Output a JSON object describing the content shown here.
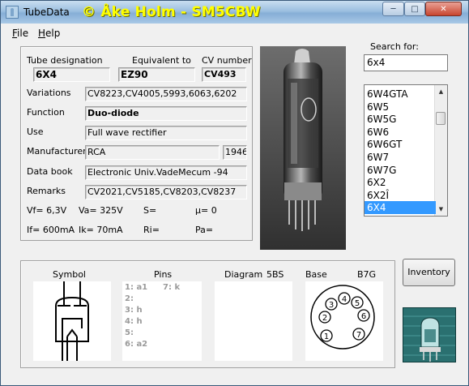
{
  "window": {
    "app_title": "TubeData",
    "banner": "© Åke Holm - SM5CBW",
    "controls": {
      "minimize": "─",
      "maximize": "□",
      "close": "✕"
    }
  },
  "menu": {
    "file": "File",
    "file_key": "F",
    "file_rest": "ile",
    "help": "Help",
    "help_key": "H",
    "help_rest": "elp"
  },
  "tube": {
    "designation_label": "Tube designation",
    "designation": "6X4",
    "equivalent_label": "Equivalent to",
    "equivalent": "EZ90",
    "cv_label": "CV number",
    "cv": "CV493",
    "variations_label": "Variations",
    "variations": "CV8223,CV4005,5993,6063,6202",
    "function_label": "Function",
    "function": "Duo-diode",
    "use_label": "Use",
    "use": "Full wave rectifier",
    "manufacturer_label": "Manufacturer",
    "manufacturer": "RCA",
    "year": "1946",
    "databook_label": "Data book",
    "databook": "Electronic Univ.VadeMecum -94",
    "remarks_label": "Remarks",
    "remarks": "CV2021,CV5185,CV8203,CV8237",
    "vf": "Vf= 6,3V",
    "va": "Va=  325V",
    "s": "S=",
    "mu": "µ=    0",
    "if": "If= 600mA",
    "ik": "Ik=   70mA",
    "ri": "Ri=",
    "pa": "Pa="
  },
  "search": {
    "label": "Search for:",
    "value": "6x4",
    "items": [
      "6W4GTA",
      "6W5",
      "6W5G",
      "6W6",
      "6W6GT",
      "6W7",
      "6W7G",
      "6X2",
      "6X2Î",
      "6X4"
    ],
    "selected": "6X4"
  },
  "bottom": {
    "symbol_label": "Symbol",
    "pins_label": "Pins",
    "pins": [
      "1: a1",
      "2:",
      "3: h",
      "4: h",
      "5:",
      "6: a2",
      "7: k"
    ],
    "diagram_label": "Diagram",
    "diagram_code": "5BS",
    "base_label": "Base",
    "base_code": "B7G",
    "base_pins": [
      "1",
      "2",
      "3",
      "4",
      "5",
      "6",
      "7"
    ],
    "inventory_button": "Inventory"
  },
  "colors": {
    "selection": "#3399ff",
    "banner_yellow": "#ffff00",
    "title_blue": "#9cbfe0"
  }
}
